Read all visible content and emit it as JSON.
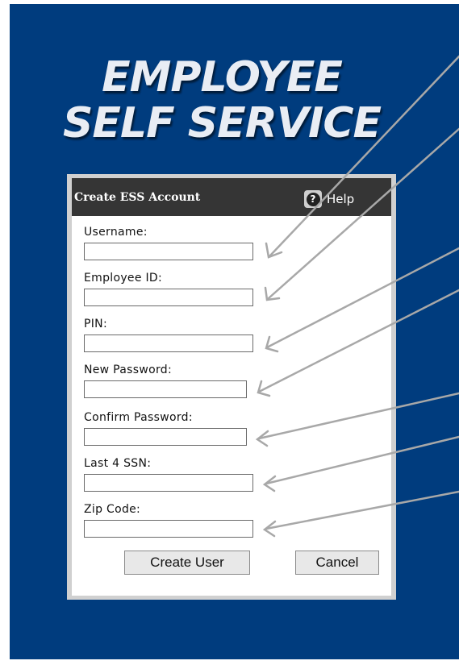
{
  "brand": {
    "line1": "EMPLOYEE",
    "line2": "SELF SERVICE"
  },
  "dialog": {
    "title": "Create ESS Account",
    "help_label": "Help",
    "help_icon": "question-icon"
  },
  "fields": {
    "username": {
      "label": "Username:",
      "value": ""
    },
    "employee_id": {
      "label": "Employee ID:",
      "value": ""
    },
    "pin": {
      "label": "PIN:",
      "value": ""
    },
    "new_password": {
      "label": "New Password:",
      "value": ""
    },
    "confirm_password": {
      "label": "Confirm Password:",
      "value": ""
    },
    "last4_ssn": {
      "label": "Last 4 SSN:",
      "value": ""
    },
    "zip_code": {
      "label": "Zip Code:",
      "value": ""
    }
  },
  "buttons": {
    "create_user": "Create User",
    "cancel": "Cancel"
  },
  "colors": {
    "background": "#003c7e",
    "titlebar": "#353535",
    "dialog_frame": "#d0d0d0",
    "arrows": "#a8a8a8"
  }
}
